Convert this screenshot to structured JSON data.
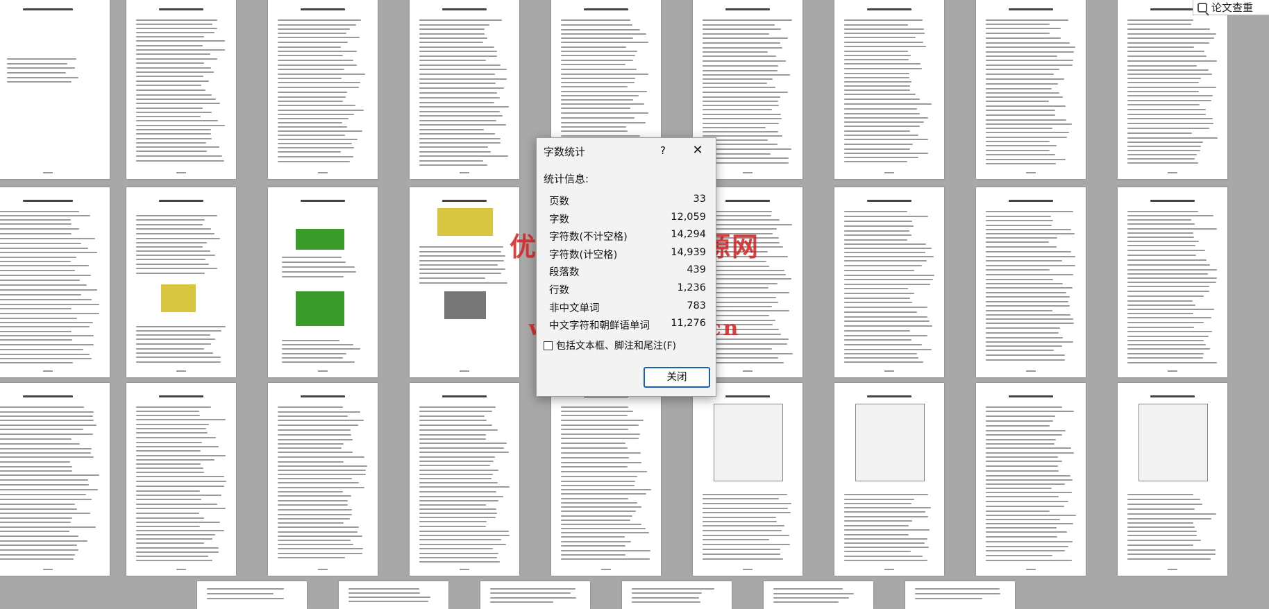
{
  "corner_widget": {
    "label": "论文查重",
    "icon": "search-doc-icon"
  },
  "watermark": {
    "line1": "优秀毕业设计资源网",
    "line2": "www.keyicad.cn"
  },
  "dialog": {
    "title": "字数统计",
    "help_label": "?",
    "close_icon": "close-icon",
    "section_label": "统计信息:",
    "stats": [
      {
        "label": "页数",
        "value": "33"
      },
      {
        "label": "字数",
        "value": "12,059"
      },
      {
        "label": "字符数(不计空格)",
        "value": "14,294"
      },
      {
        "label": "字符数(计空格)",
        "value": "14,939"
      },
      {
        "label": "段落数",
        "value": "439"
      },
      {
        "label": "行数",
        "value": "1,236"
      },
      {
        "label": "非中文单词",
        "value": "783"
      },
      {
        "label": "中文字符和朝鲜语单词",
        "value": "11,276"
      }
    ],
    "include_checkbox_label": "包括文本框、脚注和尾注(F)",
    "include_checked": false,
    "close_button_label": "关闭"
  },
  "colors": {
    "background": "#a8a8a8",
    "watermark": "#d72020",
    "accent": "#1a5fb4"
  }
}
